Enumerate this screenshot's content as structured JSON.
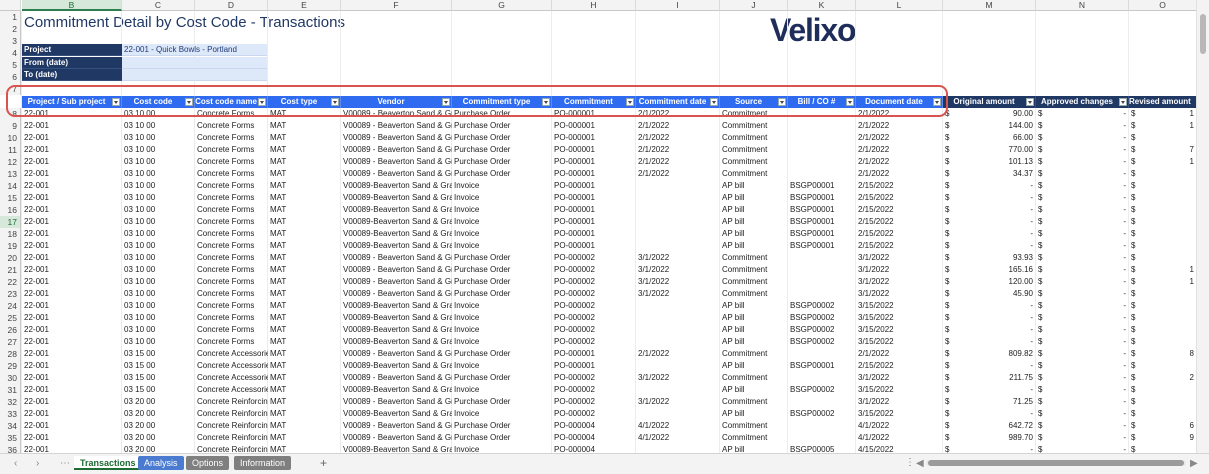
{
  "sheet": {
    "title": "Commitment Detail by Cost Code - Transactions",
    "logo_text": "Velixo",
    "column_letters": [
      "B",
      "C",
      "D",
      "E",
      "F",
      "G",
      "H",
      "I",
      "J",
      "K",
      "L",
      "M",
      "N",
      "O"
    ],
    "selected_column": "B",
    "selected_row": "17",
    "params": [
      {
        "label": "Project",
        "value": "22-001 - Quick Bowls - Portland"
      },
      {
        "label": "From (date)",
        "value": ""
      },
      {
        "label": "To (date)",
        "value": ""
      }
    ],
    "headers": [
      "Project / Sub project",
      "Cost code",
      "Cost code name",
      "Cost type",
      "Vendor",
      "Commitment type",
      "Commitment",
      "Commitment date",
      "Source",
      "Bill / CO #",
      "Document date",
      "Original amount",
      "Approved changes",
      "Revised amount"
    ],
    "rows": [
      {
        "n": "8",
        "c": [
          "22-001",
          "03 10 00",
          "Concrete Forms",
          "MAT",
          "V00089 - Beaverton Sand & Gravel",
          "Purchase Order",
          "PO-000001",
          "2/1/2022",
          "Commitment",
          "",
          "2/1/2022",
          "",
          "",
          ""
        ],
        "m": [
          "$",
          "90.00",
          "$",
          "-",
          "$",
          "1"
        ]
      },
      {
        "n": "9",
        "c": [
          "22-001",
          "03 10 00",
          "Concrete Forms",
          "MAT",
          "V00089 - Beaverton Sand & Gravel",
          "Purchase Order",
          "PO-000001",
          "2/1/2022",
          "Commitment",
          "",
          "2/1/2022",
          "",
          "",
          ""
        ],
        "m": [
          "$",
          "144.00",
          "$",
          "-",
          "$",
          "1"
        ]
      },
      {
        "n": "10",
        "c": [
          "22-001",
          "03 10 00",
          "Concrete Forms",
          "MAT",
          "V00089 - Beaverton Sand & Gravel",
          "Purchase Order",
          "PO-000001",
          "2/1/2022",
          "Commitment",
          "",
          "2/1/2022",
          "",
          "",
          ""
        ],
        "m": [
          "$",
          "66.00",
          "$",
          "-",
          "$",
          ""
        ]
      },
      {
        "n": "11",
        "c": [
          "22-001",
          "03 10 00",
          "Concrete Forms",
          "MAT",
          "V00089 - Beaverton Sand & Gravel",
          "Purchase Order",
          "PO-000001",
          "2/1/2022",
          "Commitment",
          "",
          "2/1/2022",
          "",
          "",
          ""
        ],
        "m": [
          "$",
          "770.00",
          "$",
          "-",
          "$",
          "7"
        ]
      },
      {
        "n": "12",
        "c": [
          "22-001",
          "03 10 00",
          "Concrete Forms",
          "MAT",
          "V00089 - Beaverton Sand & Gravel",
          "Purchase Order",
          "PO-000001",
          "2/1/2022",
          "Commitment",
          "",
          "2/1/2022",
          "",
          "",
          ""
        ],
        "m": [
          "$",
          "101.13",
          "$",
          "-",
          "$",
          "1"
        ]
      },
      {
        "n": "13",
        "c": [
          "22-001",
          "03 10 00",
          "Concrete Forms",
          "MAT",
          "V00089 - Beaverton Sand & Gravel",
          "Purchase Order",
          "PO-000001",
          "2/1/2022",
          "Commitment",
          "",
          "2/1/2022",
          "",
          "",
          ""
        ],
        "m": [
          "$",
          "34.37",
          "$",
          "-",
          "$",
          ""
        ]
      },
      {
        "n": "14",
        "c": [
          "22-001",
          "03 10 00",
          "Concrete Forms",
          "MAT",
          "V00089-Beaverton Sand & Gravel",
          "Invoice",
          "PO-000001",
          "",
          "AP bill",
          "BSGP00001",
          "2/15/2022",
          "",
          "",
          ""
        ],
        "m": [
          "$",
          "-",
          "$",
          "-",
          "$",
          ""
        ]
      },
      {
        "n": "15",
        "c": [
          "22-001",
          "03 10 00",
          "Concrete Forms",
          "MAT",
          "V00089-Beaverton Sand & Gravel",
          "Invoice",
          "PO-000001",
          "",
          "AP bill",
          "BSGP00001",
          "2/15/2022",
          "",
          "",
          ""
        ],
        "m": [
          "$",
          "-",
          "$",
          "-",
          "$",
          ""
        ]
      },
      {
        "n": "16",
        "c": [
          "22-001",
          "03 10 00",
          "Concrete Forms",
          "MAT",
          "V00089-Beaverton Sand & Gravel",
          "Invoice",
          "PO-000001",
          "",
          "AP bill",
          "BSGP00001",
          "2/15/2022",
          "",
          "",
          ""
        ],
        "m": [
          "$",
          "-",
          "$",
          "-",
          "$",
          ""
        ]
      },
      {
        "n": "17",
        "c": [
          "22-001",
          "03 10 00",
          "Concrete Forms",
          "MAT",
          "V00089-Beaverton Sand & Gravel",
          "Invoice",
          "PO-000001",
          "",
          "AP bill",
          "BSGP00001",
          "2/15/2022",
          "",
          "",
          ""
        ],
        "m": [
          "$",
          "-",
          "$",
          "-",
          "$",
          ""
        ]
      },
      {
        "n": "18",
        "c": [
          "22-001",
          "03 10 00",
          "Concrete Forms",
          "MAT",
          "V00089-Beaverton Sand & Gravel",
          "Invoice",
          "PO-000001",
          "",
          "AP bill",
          "BSGP00001",
          "2/15/2022",
          "",
          "",
          ""
        ],
        "m": [
          "$",
          "-",
          "$",
          "-",
          "$",
          ""
        ]
      },
      {
        "n": "19",
        "c": [
          "22-001",
          "03 10 00",
          "Concrete Forms",
          "MAT",
          "V00089-Beaverton Sand & Gravel",
          "Invoice",
          "PO-000001",
          "",
          "AP bill",
          "BSGP00001",
          "2/15/2022",
          "",
          "",
          ""
        ],
        "m": [
          "$",
          "-",
          "$",
          "-",
          "$",
          ""
        ]
      },
      {
        "n": "20",
        "c": [
          "22-001",
          "03 10 00",
          "Concrete Forms",
          "MAT",
          "V00089 - Beaverton Sand & Gravel",
          "Purchase Order",
          "PO-000002",
          "3/1/2022",
          "Commitment",
          "",
          "3/1/2022",
          "",
          "",
          ""
        ],
        "m": [
          "$",
          "93.93",
          "$",
          "-",
          "$",
          ""
        ]
      },
      {
        "n": "21",
        "c": [
          "22-001",
          "03 10 00",
          "Concrete Forms",
          "MAT",
          "V00089 - Beaverton Sand & Gravel",
          "Purchase Order",
          "PO-000002",
          "3/1/2022",
          "Commitment",
          "",
          "3/1/2022",
          "",
          "",
          ""
        ],
        "m": [
          "$",
          "165.16",
          "$",
          "-",
          "$",
          "1"
        ]
      },
      {
        "n": "22",
        "c": [
          "22-001",
          "03 10 00",
          "Concrete Forms",
          "MAT",
          "V00089 - Beaverton Sand & Gravel",
          "Purchase Order",
          "PO-000002",
          "3/1/2022",
          "Commitment",
          "",
          "3/1/2022",
          "",
          "",
          ""
        ],
        "m": [
          "$",
          "120.00",
          "$",
          "-",
          "$",
          "1"
        ]
      },
      {
        "n": "23",
        "c": [
          "22-001",
          "03 10 00",
          "Concrete Forms",
          "MAT",
          "V00089 - Beaverton Sand & Gravel",
          "Purchase Order",
          "PO-000002",
          "3/1/2022",
          "Commitment",
          "",
          "3/1/2022",
          "",
          "",
          ""
        ],
        "m": [
          "$",
          "45.90",
          "$",
          "-",
          "$",
          ""
        ]
      },
      {
        "n": "24",
        "c": [
          "22-001",
          "03 10 00",
          "Concrete Forms",
          "MAT",
          "V00089-Beaverton Sand & Gravel",
          "Invoice",
          "PO-000002",
          "",
          "AP bill",
          "BSGP00002",
          "3/15/2022",
          "",
          "",
          ""
        ],
        "m": [
          "$",
          "-",
          "$",
          "-",
          "$",
          ""
        ]
      },
      {
        "n": "25",
        "c": [
          "22-001",
          "03 10 00",
          "Concrete Forms",
          "MAT",
          "V00089-Beaverton Sand & Gravel",
          "Invoice",
          "PO-000002",
          "",
          "AP bill",
          "BSGP00002",
          "3/15/2022",
          "",
          "",
          ""
        ],
        "m": [
          "$",
          "-",
          "$",
          "-",
          "$",
          ""
        ]
      },
      {
        "n": "26",
        "c": [
          "22-001",
          "03 10 00",
          "Concrete Forms",
          "MAT",
          "V00089-Beaverton Sand & Gravel",
          "Invoice",
          "PO-000002",
          "",
          "AP bill",
          "BSGP00002",
          "3/15/2022",
          "",
          "",
          ""
        ],
        "m": [
          "$",
          "-",
          "$",
          "-",
          "$",
          ""
        ]
      },
      {
        "n": "27",
        "c": [
          "22-001",
          "03 10 00",
          "Concrete Forms",
          "MAT",
          "V00089-Beaverton Sand & Gravel",
          "Invoice",
          "PO-000002",
          "",
          "AP bill",
          "BSGP00002",
          "3/15/2022",
          "",
          "",
          ""
        ],
        "m": [
          "$",
          "-",
          "$",
          "-",
          "$",
          ""
        ]
      },
      {
        "n": "28",
        "c": [
          "22-001",
          "03 15 00",
          "Concrete Accessories",
          "MAT",
          "V00089 - Beaverton Sand & Gravel",
          "Purchase Order",
          "PO-000001",
          "2/1/2022",
          "Commitment",
          "",
          "2/1/2022",
          "",
          "",
          ""
        ],
        "m": [
          "$",
          "809.82",
          "$",
          "-",
          "$",
          "8"
        ]
      },
      {
        "n": "29",
        "c": [
          "22-001",
          "03 15 00",
          "Concrete Accessories",
          "MAT",
          "V00089-Beaverton Sand & Gravel",
          "Invoice",
          "PO-000001",
          "",
          "AP bill",
          "BSGP00001",
          "2/15/2022",
          "",
          "",
          ""
        ],
        "m": [
          "$",
          "-",
          "$",
          "-",
          "$",
          ""
        ]
      },
      {
        "n": "30",
        "c": [
          "22-001",
          "03 15 00",
          "Concrete Accessories",
          "MAT",
          "V00089 - Beaverton Sand & Gravel",
          "Purchase Order",
          "PO-000002",
          "3/1/2022",
          "Commitment",
          "",
          "3/1/2022",
          "",
          "",
          ""
        ],
        "m": [
          "$",
          "211.75",
          "$",
          "-",
          "$",
          "2"
        ]
      },
      {
        "n": "31",
        "c": [
          "22-001",
          "03 15 00",
          "Concrete Accessories",
          "MAT",
          "V00089-Beaverton Sand & Gravel",
          "Invoice",
          "PO-000002",
          "",
          "AP bill",
          "BSGP00002",
          "3/15/2022",
          "",
          "",
          ""
        ],
        "m": [
          "$",
          "-",
          "$",
          "-",
          "$",
          ""
        ]
      },
      {
        "n": "32",
        "c": [
          "22-001",
          "03 20 00",
          "Concrete Reinforcing",
          "MAT",
          "V00089 - Beaverton Sand & Gravel",
          "Purchase Order",
          "PO-000002",
          "3/1/2022",
          "Commitment",
          "",
          "3/1/2022",
          "",
          "",
          ""
        ],
        "m": [
          "$",
          "71.25",
          "$",
          "-",
          "$",
          ""
        ]
      },
      {
        "n": "33",
        "c": [
          "22-001",
          "03 20 00",
          "Concrete Reinforcing",
          "MAT",
          "V00089-Beaverton Sand & Gravel",
          "Invoice",
          "PO-000002",
          "",
          "AP bill",
          "BSGP00002",
          "3/15/2022",
          "",
          "",
          ""
        ],
        "m": [
          "$",
          "-",
          "$",
          "-",
          "$",
          ""
        ]
      },
      {
        "n": "34",
        "c": [
          "22-001",
          "03 20 00",
          "Concrete Reinforcing",
          "MAT",
          "V00089 - Beaverton Sand & Gravel",
          "Purchase Order",
          "PO-000004",
          "4/1/2022",
          "Commitment",
          "",
          "4/1/2022",
          "",
          "",
          ""
        ],
        "m": [
          "$",
          "642.72",
          "$",
          "-",
          "$",
          "6"
        ]
      },
      {
        "n": "35",
        "c": [
          "22-001",
          "03 20 00",
          "Concrete Reinforcing",
          "MAT",
          "V00089 - Beaverton Sand & Gravel",
          "Purchase Order",
          "PO-000004",
          "4/1/2022",
          "Commitment",
          "",
          "4/1/2022",
          "",
          "",
          ""
        ],
        "m": [
          "$",
          "989.70",
          "$",
          "-",
          "$",
          "9"
        ]
      },
      {
        "n": "36",
        "c": [
          "22-001",
          "03 20 00",
          "Concrete Reinforcing",
          "MAT",
          "V00089-Beaverton Sand & Gravel",
          "Invoice",
          "PO-000004",
          "",
          "AP bill",
          "BSGP00005",
          "4/15/2022",
          "",
          "",
          ""
        ],
        "m": [
          "$",
          "-",
          "$",
          "-",
          "$",
          ""
        ]
      }
    ],
    "tabs": [
      "Transactions",
      "Analysis",
      "Options",
      "Information"
    ],
    "active_tab": "Transactions",
    "add_sheet": "+",
    "colors": {
      "header_blue": "#2f6bf0",
      "navy": "#203864",
      "highlight_red": "#d9534f",
      "active_tab_green": "#1e6b34"
    }
  }
}
